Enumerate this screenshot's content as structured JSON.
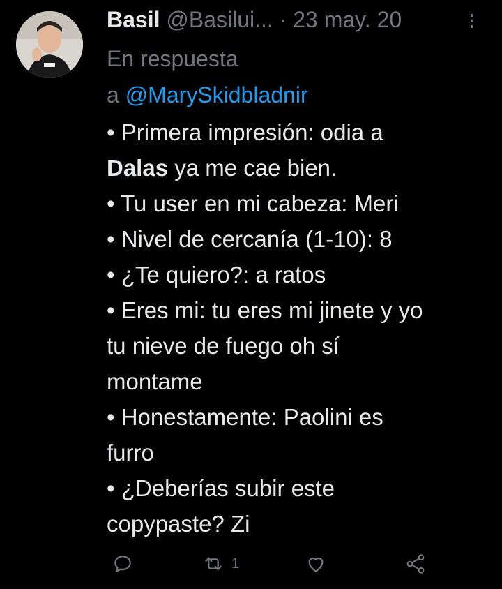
{
  "author": {
    "name": "Basil",
    "handle": "@Basilui...",
    "separator": "·",
    "date": "23 may. 20"
  },
  "reply_context": {
    "prefix_line1": "En respuesta",
    "prefix_line2": "a",
    "mention": "@MarySkidbladnir"
  },
  "tweet": {
    "line1": "• Primera impresión: odia a",
    "line2_bold": "Dalas",
    "line2_rest": " ya me cae bien.",
    "line3": "• Tu user en mi cabeza: Meri",
    "line4": "• Nivel de cercanía (1-10): 8",
    "line5": "• ¿Te quiero?: a ratos",
    "line6": "• Eres mi: tu eres mi jinete y yo",
    "line7": "tu nieve de fuego oh sí",
    "line8": "montame",
    "line9": "• Honestamente: Paolini es",
    "line10": "furro",
    "line11": "• ¿Deberías subir este",
    "line12": "copypaste? Zi"
  },
  "actions": {
    "reply_icon": "comment-icon",
    "retweet_icon": "retweet-icon",
    "retweet_count": "1",
    "like_icon": "heart-icon",
    "share_icon": "share-icon"
  },
  "colors": {
    "background": "#000000",
    "text": "#e7e9ea",
    "muted": "#71767b",
    "link": "#1d9bf0"
  }
}
